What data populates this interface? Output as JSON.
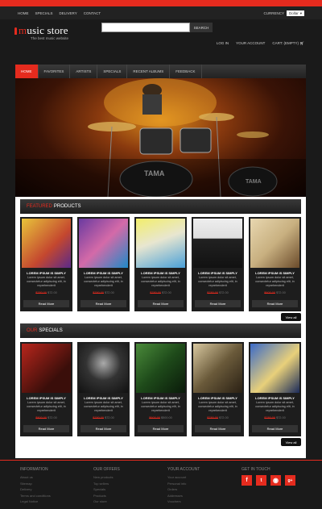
{
  "topnav": {
    "items": [
      "HOME",
      "SPECIALS",
      "DELIVERY",
      "CONTACT"
    ],
    "currency_label": "CURRENCY",
    "currency_value": "Dollar"
  },
  "logo": {
    "title_m": "m",
    "title_rest": "usic store",
    "tagline": "The best music website"
  },
  "search": {
    "placeholder": "",
    "button": "SEARCH"
  },
  "account": [
    "LOG IN",
    "YOUR ACCOUNT",
    "CART: (EMPTY)"
  ],
  "mainnav": [
    "HOME",
    "FAVORITES",
    "ARTISTS",
    "SPECIALS",
    "RECENT ALBUMS",
    "FEEDBACK"
  ],
  "featured": {
    "title_a": "FEATURED",
    "title_b": "PRODUCTS",
    "products": [
      {
        "name": "LOREM IPSUM IS SIMPLY",
        "desc": "Lorem ipsum dolor sit amet, consectetur adipiscing elit, in reprehenderit",
        "old": "$780.00",
        "new": "$72.00"
      },
      {
        "name": "LOREM IPSUM IS SIMPLY",
        "desc": "Lorem ipsum dolor sit amet, consectetur adipiscing elit, in reprehenderit",
        "old": "$780.00",
        "new": "$72.00"
      },
      {
        "name": "LOREM IPSUM IS SIMPLY",
        "desc": "Lorem ipsum dolor sit amet, consectetur adipiscing elit, in reprehenderit",
        "old": "$780.00",
        "new": "$72.00"
      },
      {
        "name": "LOREM IPSUM IS SIMPLY",
        "desc": "Lorem ipsum dolor sit amet, consectetur adipiscing elit, in reprehenderit",
        "old": "$780.00",
        "new": "$72.00"
      },
      {
        "name": "LOREM IPSUM IS SIMPLY",
        "desc": "Lorem ipsum dolor sit amet, consectetur adipiscing elit, in reprehenderit",
        "old": "$600.00",
        "new": "$72.00"
      }
    ]
  },
  "specials": {
    "title_a": "OUR",
    "title_b": "SPECIALS",
    "products": [
      {
        "name": "LOREM IPSUM IS SIMPLY",
        "desc": "Lorem ipsum dolor sit amet, consectetur adipiscing elit, in reprehenderit",
        "old": "$800.00",
        "new": "$72.00"
      },
      {
        "name": "LOREM IPSUM IS SIMPLY",
        "desc": "Lorem ipsum dolor sit amet, consectetur adipiscing elit, in reprehenderit",
        "old": "$780.00",
        "new": "$72.00"
      },
      {
        "name": "LOREM IPSUM IS SIMPLY",
        "desc": "Lorem ipsum dolor sit amet, consectetur adipiscing elit, in reprehenderit",
        "old": "$600.00",
        "new": "$500.00"
      },
      {
        "name": "LOREM IPSUM IS SIMPLY",
        "desc": "Lorem ipsum dolor sit amet, consectetur adipiscing elit, in reprehenderit",
        "old": "$780.00",
        "new": "$72.00"
      },
      {
        "name": "LOREM IPSUM IS SIMPLY",
        "desc": "Lorem ipsum dolor sit amet, consectetur adipiscing elit, in reprehenderit",
        "old": "$780.00",
        "new": "$72.00"
      }
    ]
  },
  "read_more": "Read More",
  "view_all": "View all",
  "footer": {
    "information": {
      "title": "INFORMATION",
      "links": [
        "About us",
        "Sitemap",
        "Delivery",
        "Terms and conditions",
        "Legal Notice"
      ]
    },
    "our_offers": {
      "title": "OUR OFFERS",
      "links": [
        "New products",
        "Top sellers",
        "Specials",
        "Products",
        "Our store"
      ]
    },
    "your_account": {
      "title": "YOUR ACCOUNT",
      "links": [
        "Your account",
        "Personal info",
        "Orders",
        "Addresses",
        "Vouchers"
      ]
    },
    "follow": {
      "title": "GET IN TOUCH",
      "icons": [
        "f",
        "t",
        "rss",
        "g+"
      ]
    }
  },
  "colors": {
    "accent": "#e52b1e",
    "background": "#1a1a1a"
  }
}
